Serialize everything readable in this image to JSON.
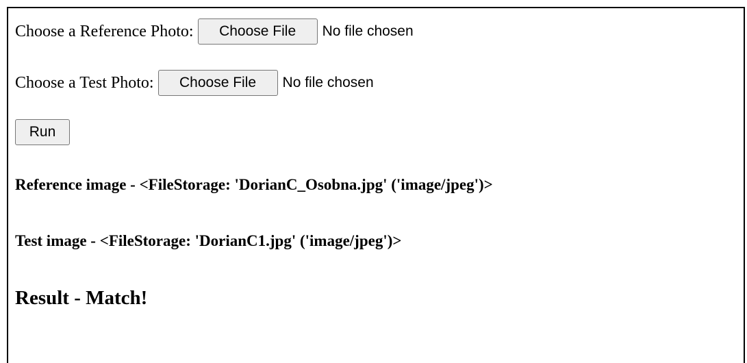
{
  "reference": {
    "label": "Choose a Reference Photo:",
    "button_label": "Choose File",
    "status": "No file chosen"
  },
  "test": {
    "label": "Choose a Test Photo:",
    "button_label": "Choose File",
    "status": "No file chosen"
  },
  "run": {
    "button_label": "Run"
  },
  "output": {
    "reference_image": "Reference image - <FileStorage: 'DorianC_Osobna.jpg' ('image/jpeg')>",
    "test_image": "Test image - <FileStorage: 'DorianC1.jpg' ('image/jpeg')>",
    "result": "Result - Match!"
  }
}
